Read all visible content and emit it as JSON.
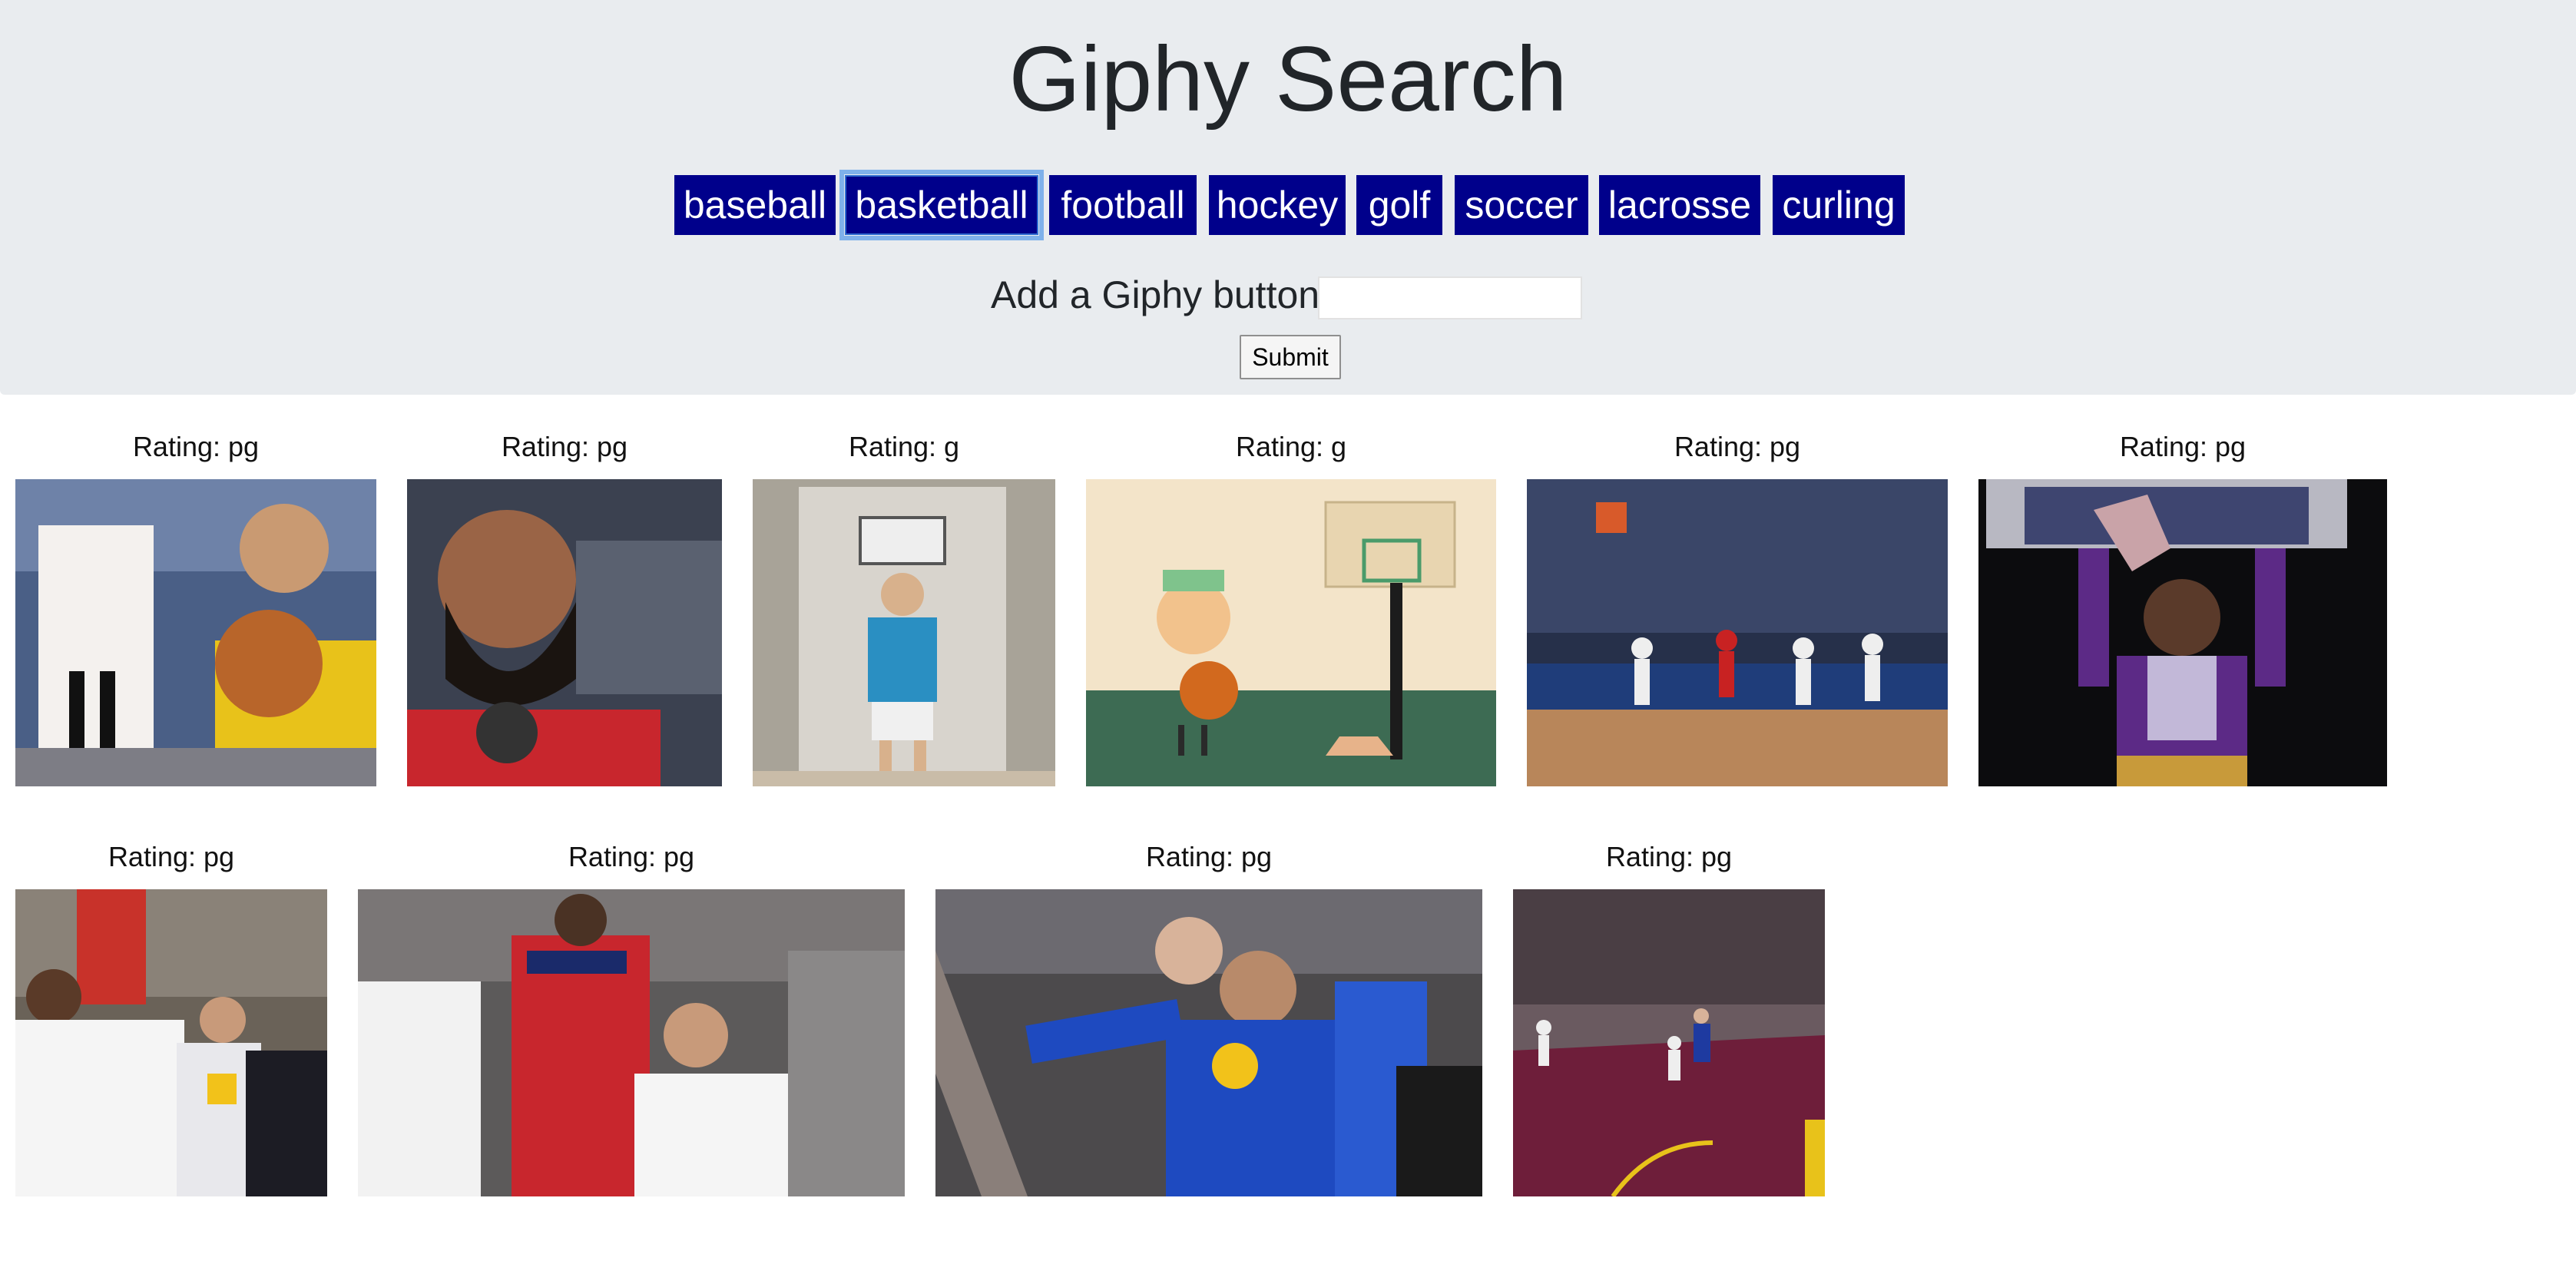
{
  "header": {
    "title": "Giphy Search"
  },
  "topic_buttons": [
    {
      "label": "baseball"
    },
    {
      "label": "basketball",
      "focused": true
    },
    {
      "label": "football"
    },
    {
      "label": "hockey"
    },
    {
      "label": "golf"
    },
    {
      "label": "soccer"
    },
    {
      "label": "lacrosse"
    },
    {
      "label": "curling"
    }
  ],
  "add_form": {
    "label": "Add a Giphy button:",
    "input_value": "",
    "input_placeholder": "",
    "submit_label": "Submit"
  },
  "colors": {
    "jumbotron_bg": "#e9ecef",
    "button_bg": "#00008b",
    "button_text": "#ffffff",
    "focus_ring": "#7fb1ea"
  },
  "gifs": [
    {
      "rating": "Rating: pg",
      "scene": "player-holding-ball-yellow-shirt"
    },
    {
      "rating": "Rating: pg",
      "scene": "bearded-player-interview-red-jersey"
    },
    {
      "rating": "Rating: g",
      "scene": "kid-mini-hoop-on-door"
    },
    {
      "rating": "Rating: g",
      "scene": "cartoon-ice-cream-with-basketball"
    },
    {
      "rating": "Rating: pg",
      "scene": "game-action-on-court"
    },
    {
      "rating": "Rating: pg",
      "scene": "purple-costume-dunk"
    },
    {
      "rating": "Rating: pg",
      "scene": "bench-celebration-warriors"
    },
    {
      "rating": "Rating: pg",
      "scene": "raptors-wizards-players"
    },
    {
      "rating": "Rating: pg",
      "scene": "fans-celebrating-blue-shirts"
    },
    {
      "rating": "Rating: pg",
      "scene": "arena-wide-shot-court"
    }
  ]
}
